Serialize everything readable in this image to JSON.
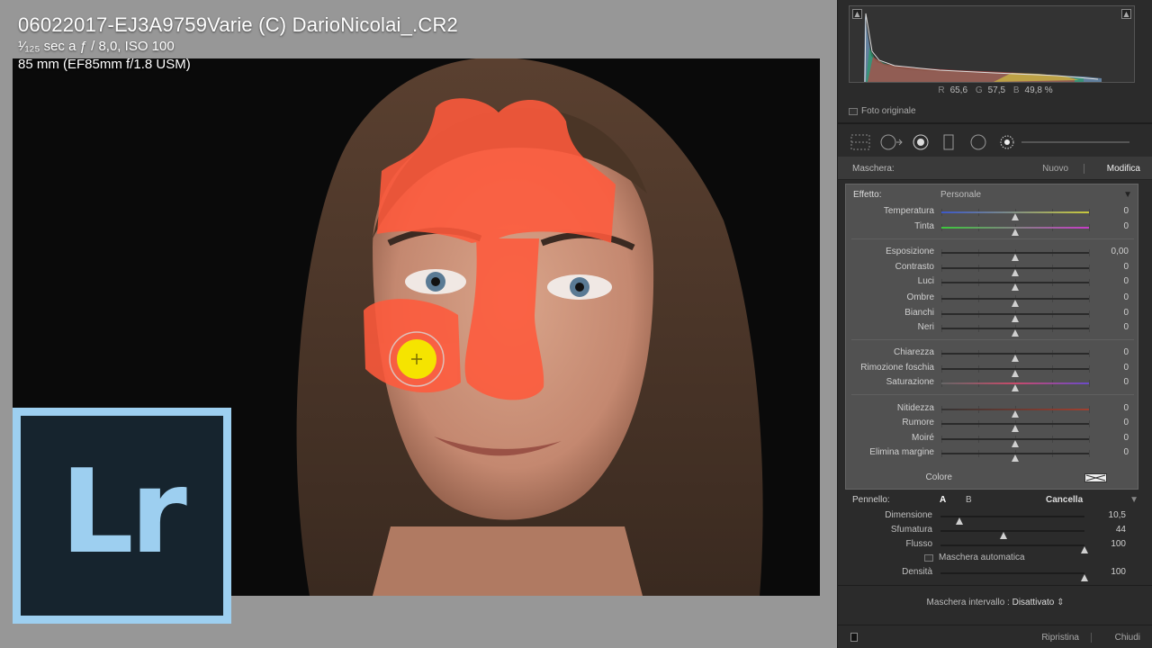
{
  "photo_info": {
    "filename": "06022017-EJ3A9759Varie (C) DarioNicolai_.CR2",
    "exposure": "¹⁄₁₂₅ sec a ƒ / 8,0, ISO 100",
    "lens": "85 mm (EF85mm f/1.8 USM)"
  },
  "logo_text": "Lr",
  "histogram": {
    "r_label": "R",
    "r_value": "65,6",
    "g_label": "G",
    "g_value": "57,5",
    "b_label": "B",
    "b_value": "49,8 %",
    "original_photo_label": "Foto originale"
  },
  "mask": {
    "label": "Maschera:",
    "new_label": "Nuovo",
    "edit_label": "Modifica"
  },
  "effect": {
    "label": "Effetto:",
    "preset": "Personale",
    "color_label": "Colore",
    "sliders": [
      {
        "label": "Temperatura",
        "value": "0",
        "pos": 0.5
      },
      {
        "label": "Tinta",
        "value": "0",
        "pos": 0.5
      },
      {
        "label": "Esposizione",
        "value": "0,00",
        "pos": 0.5
      },
      {
        "label": "Contrasto",
        "value": "0",
        "pos": 0.5
      },
      {
        "label": "Luci",
        "value": "0",
        "pos": 0.5
      },
      {
        "label": "Ombre",
        "value": "0",
        "pos": 0.5
      },
      {
        "label": "Bianchi",
        "value": "0",
        "pos": 0.5
      },
      {
        "label": "Neri",
        "value": "0",
        "pos": 0.5
      },
      {
        "label": "Chiarezza",
        "value": "0",
        "pos": 0.5
      },
      {
        "label": "Rimozione foschia",
        "value": "0",
        "pos": 0.5
      },
      {
        "label": "Saturazione",
        "value": "0",
        "pos": 0.5
      },
      {
        "label": "Nitidezza",
        "value": "0",
        "pos": 0.5
      },
      {
        "label": "Rumore",
        "value": "0",
        "pos": 0.5
      },
      {
        "label": "Moiré",
        "value": "0",
        "pos": 0.5
      },
      {
        "label": "Elimina margine",
        "value": "0",
        "pos": 0.5
      }
    ]
  },
  "brush": {
    "label": "Pennello:",
    "a_label": "A",
    "b_label": "B",
    "erase_label": "Cancella",
    "sliders": [
      {
        "label": "Dimensione",
        "value": "10,5",
        "pos": 0.13
      },
      {
        "label": "Sfumatura",
        "value": "44",
        "pos": 0.44
      },
      {
        "label": "Flusso",
        "value": "100",
        "pos": 1.0
      }
    ],
    "auto_mask_label": "Maschera automatica",
    "density_label": "Densità",
    "density_value": "100",
    "density_pos": 1.0,
    "range_mask_label": "Maschera intervallo :",
    "range_mask_value": "Disattivato"
  },
  "footer": {
    "reset_label": "Ripristina",
    "close_label": "Chiudi"
  },
  "colors": {
    "mask_overlay": "#ff5a3c",
    "brush_pin": "#f5e400",
    "logo_blue": "#9dcff0",
    "logo_bg": "#16242e",
    "panel_bg": "#2b2b2b"
  }
}
